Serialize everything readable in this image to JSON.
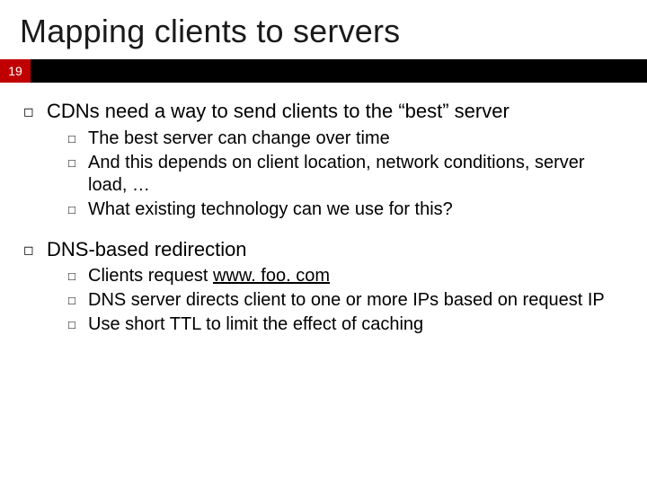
{
  "slide": {
    "title": "Mapping clients to servers",
    "page_number": "19",
    "sections": [
      {
        "heading": "CDNs need a way to send clients to the “best” server",
        "subs": [
          {
            "pre": "The",
            "rest": " best server can change over time"
          },
          {
            "pre": "And",
            "rest": " this depends on client location, network conditions, server load, …"
          },
          {
            "pre": "What",
            "rest": " existing technology can we use for this?"
          }
        ]
      },
      {
        "heading": "DNS-based redirection",
        "subs": [
          {
            "pre": "Clients",
            "rest_before_link": " request ",
            "link": "www. foo. com",
            "rest_after_link": ""
          },
          {
            "pre": "DNS",
            "rest": " server directs client to one or more IPs based on request IP"
          },
          {
            "pre": "Use",
            "rest": " short TTL to limit the effect of caching"
          }
        ]
      }
    ]
  }
}
